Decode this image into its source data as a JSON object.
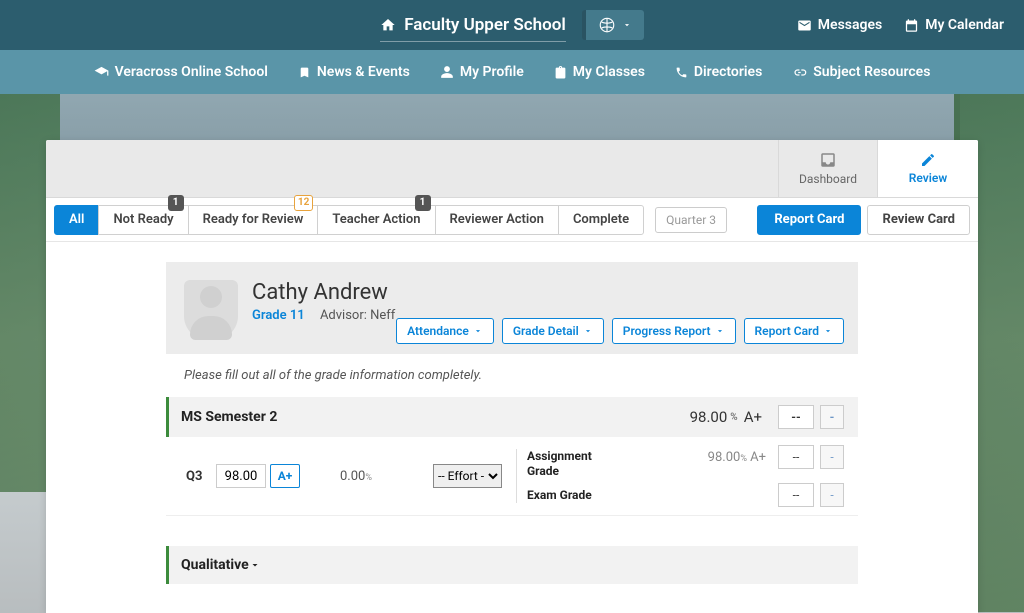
{
  "topbar": {
    "title": "Faculty Upper School",
    "messages": "Messages",
    "calendar": "My Calendar"
  },
  "nav": {
    "school": "Veracross Online School",
    "news": "News & Events",
    "profile": "My Profile",
    "classes": "My Classes",
    "directories": "Directories",
    "resources": "Subject Resources"
  },
  "tabs": {
    "dashboard": "Dashboard",
    "review": "Review"
  },
  "filters": {
    "all": "All",
    "not_ready": "Not Ready",
    "not_ready_badge": "1",
    "ready": "Ready for Review",
    "ready_badge": "12",
    "teacher": "Teacher Action",
    "teacher_badge": "1",
    "reviewer": "Reviewer Action",
    "complete": "Complete",
    "quarter": "Quarter 3",
    "report_card_btn": "Report Card",
    "review_card_btn": "Review Card"
  },
  "student": {
    "name": "Cathy Andrew",
    "grade": "Grade 11",
    "advisor_label": "Advisor: Neff",
    "actions": {
      "attendance": "Attendance",
      "grade_detail": "Grade Detail",
      "progress_report": "Progress Report",
      "report_card": "Report Card"
    }
  },
  "instruction": "Please fill out all of the grade information completely.",
  "semester": {
    "title": "MS Semester 2",
    "grade": "98.00",
    "pct": "%",
    "letter": "A+",
    "dash": "--",
    "dropdown": "-",
    "q_label": "Q3",
    "q_grade": "98.00",
    "q_letter": "A+",
    "q_zero": "0.00",
    "q_zero_pct": "%",
    "effort": "-- Effort -",
    "assign_label": "Assignment Grade",
    "assign_grade": "98.00",
    "assign_pct": "%",
    "assign_letter": "A+",
    "exam_label": "Exam Grade"
  },
  "qualitative": {
    "title": "Qualitative"
  }
}
